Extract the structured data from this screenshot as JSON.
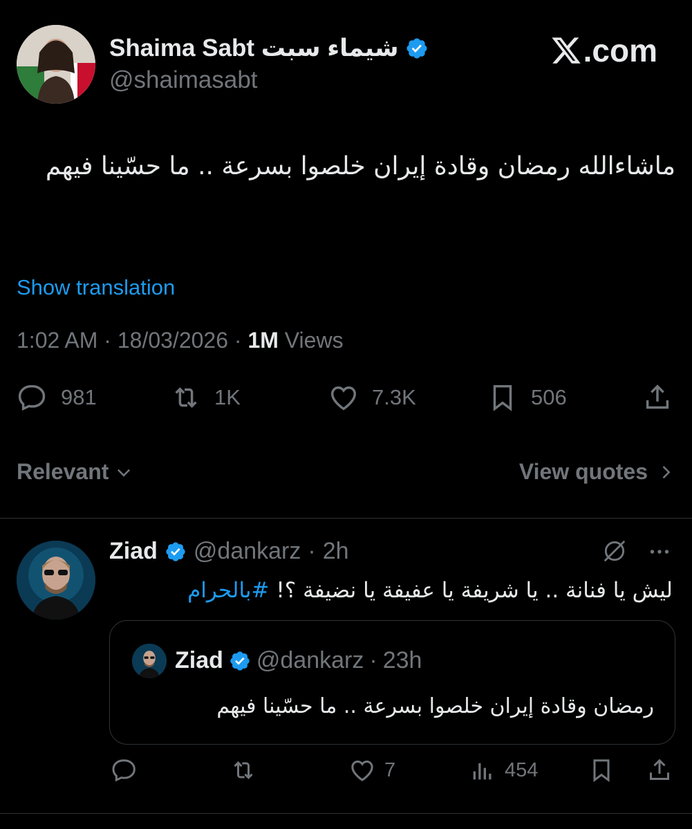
{
  "site_label": ".com",
  "author": {
    "display_name": "Shaima Sabt شيماء سبت",
    "handle": "@shaimasabt"
  },
  "tweet": {
    "text": "ماشاءالله رمضان وقادة إيران خلصوا بسرعة .. ما حسّينا فيهم",
    "show_translation": "Show translation",
    "time": "1:02 AM",
    "date": "18/03/2026",
    "views_count": "1M",
    "views_label": "Views",
    "sep": "·"
  },
  "stats": {
    "replies": "981",
    "reposts": "1K",
    "likes": "7.3K",
    "bookmarks": "506"
  },
  "sort": {
    "relevant": "Relevant",
    "view_quotes": "View quotes"
  },
  "reply": {
    "name": "Ziad",
    "handle": "@dankarz",
    "time": "2h",
    "text": "ليش يا فنانة .. يا شريفة يا عفيفة يا نضيفة ؟! ",
    "hashtag": "#بالحرام",
    "likes": "7",
    "views": "454"
  },
  "quote": {
    "name": "Ziad",
    "handle": "@dankarz",
    "time": "23h",
    "text": "رمضان وقادة إيران خلصوا بسرعة .. ما حسّينا فيهم"
  },
  "colors": {
    "background": "#000000",
    "text": "#e7e9ea",
    "muted": "#71767b",
    "accent": "#1d9bf0",
    "border": "#2f3336"
  },
  "icons": [
    "verified-badge-icon",
    "x-logo-icon",
    "reply-icon",
    "repost-icon",
    "like-icon",
    "bookmark-icon",
    "share-icon",
    "chevron-down-icon",
    "chevron-right-icon",
    "grok-icon",
    "more-icon",
    "views-icon"
  ]
}
